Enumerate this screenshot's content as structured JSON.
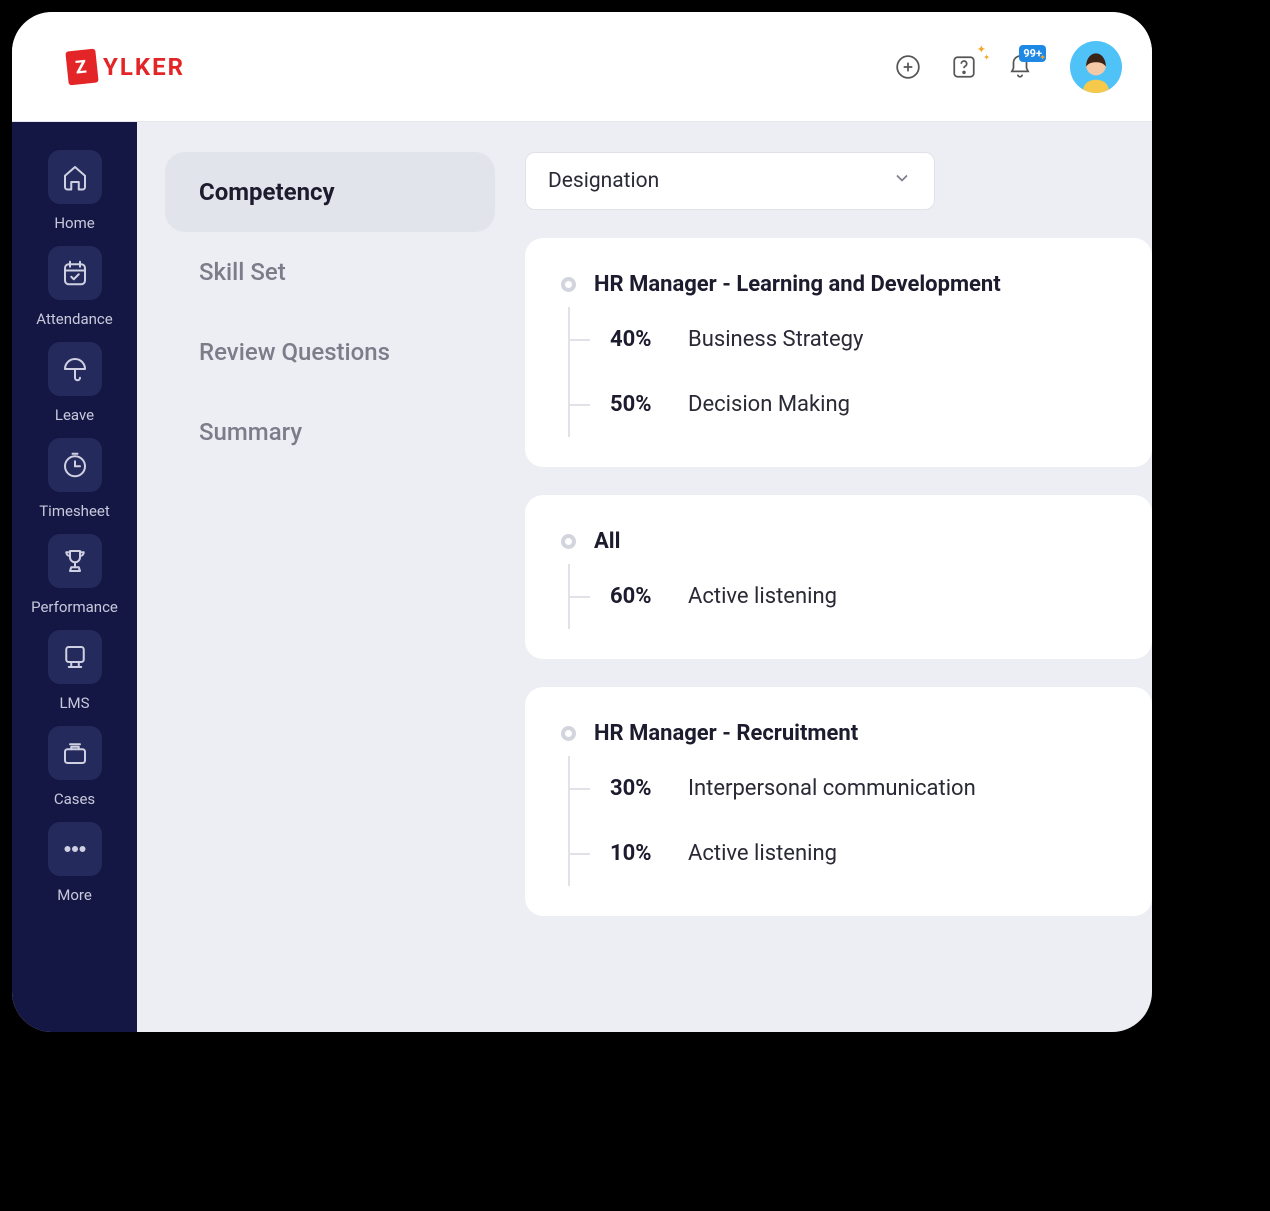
{
  "header": {
    "brand": "YLKER",
    "brand_box": "Z",
    "notification_badge": "99+"
  },
  "sidebar": {
    "items": [
      {
        "label": "Home"
      },
      {
        "label": "Attendance"
      },
      {
        "label": "Leave"
      },
      {
        "label": "Timesheet"
      },
      {
        "label": "Performance"
      },
      {
        "label": "LMS"
      },
      {
        "label": "Cases"
      },
      {
        "label": "More"
      }
    ]
  },
  "tabs": [
    {
      "label": "Competency",
      "active": true
    },
    {
      "label": "Skill Set"
    },
    {
      "label": "Review Questions"
    },
    {
      "label": "Summary"
    }
  ],
  "filter": {
    "selected": "Designation"
  },
  "groups": [
    {
      "title": "HR Manager - Learning and Development",
      "items": [
        {
          "pct": "40%",
          "label": "Business Strategy"
        },
        {
          "pct": "50%",
          "label": "Decision Making"
        }
      ]
    },
    {
      "title": "All",
      "items": [
        {
          "pct": "60%",
          "label": "Active listening"
        }
      ]
    },
    {
      "title": "HR Manager - Recruitment",
      "items": [
        {
          "pct": "30%",
          "label": "Interpersonal communication"
        },
        {
          "pct": "10%",
          "label": "Active listening"
        }
      ]
    }
  ]
}
